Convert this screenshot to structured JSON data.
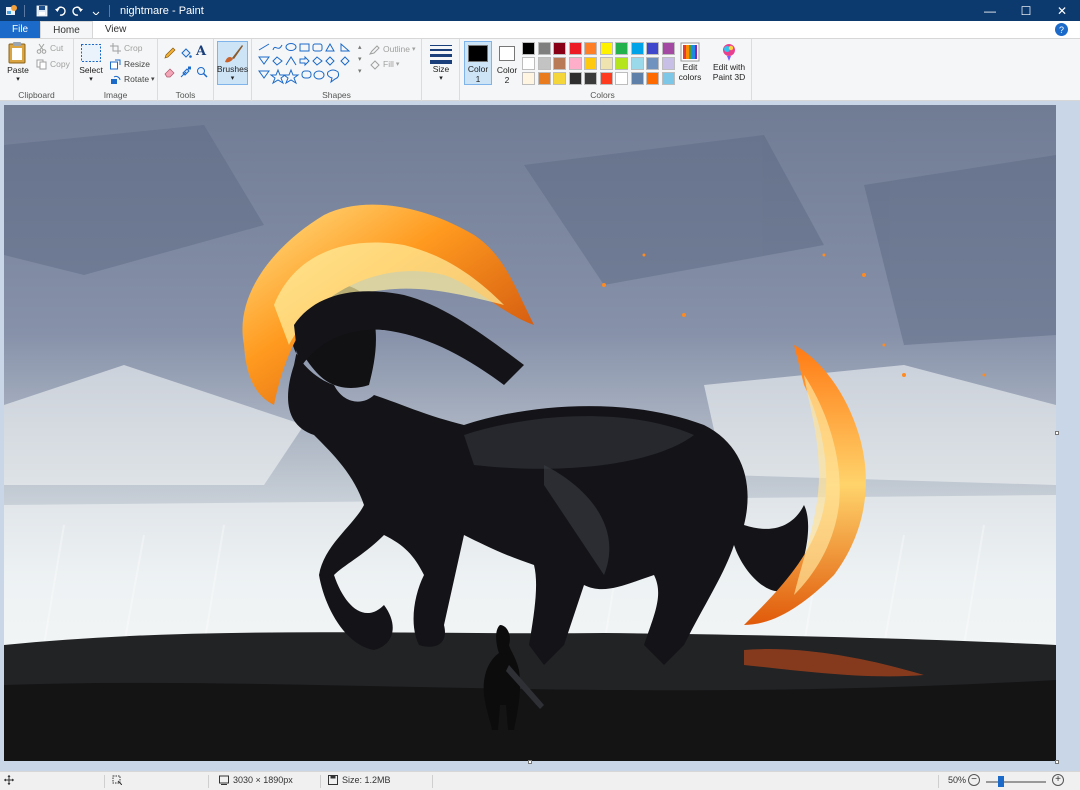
{
  "window": {
    "title": "nightmare - Paint",
    "minimize_glyph": "—",
    "maximize_glyph": "☐",
    "close_glyph": "✕"
  },
  "quick_access": {
    "items": [
      "save-icon",
      "undo-icon",
      "redo-icon",
      "customize-icon"
    ]
  },
  "tabs": {
    "file": "File",
    "home": "Home",
    "view": "View",
    "help_glyph": "?"
  },
  "clipboard": {
    "paste": "Paste",
    "cut": "Cut",
    "copy": "Copy",
    "label": "Clipboard"
  },
  "image": {
    "select": "Select",
    "crop": "Crop",
    "resize": "Resize",
    "rotate": "Rotate",
    "label": "Image"
  },
  "tools": {
    "label": "Tools",
    "text_glyph": "A"
  },
  "brushes": {
    "label": "Brushes"
  },
  "shapes": {
    "outline": "Outline",
    "fill": "Fill",
    "label": "Shapes"
  },
  "size": {
    "label": "Size"
  },
  "colors": {
    "color1_label": "Color",
    "color1_num": "1",
    "color2_label": "Color",
    "color2_num": "2",
    "color1_value": "#000000",
    "color2_value": "#ffffff",
    "edit_colors_l1": "Edit",
    "edit_colors_l2": "colors",
    "edit_3d_l1": "Edit with",
    "edit_3d_l2": "Paint 3D",
    "label": "Colors",
    "palette_row1": [
      "#000000",
      "#7f7f7f",
      "#880015",
      "#ed1c24",
      "#ff7f27",
      "#fff200",
      "#22b14c",
      "#00a2e8",
      "#3f48cc",
      "#a349a4"
    ],
    "palette_row2": [
      "#ffffff",
      "#c3c3c3",
      "#b97a57",
      "#ffaec9",
      "#ffc90e",
      "#efe4b0",
      "#b5e61d",
      "#99d9ea",
      "#7092be",
      "#c8bfe7"
    ],
    "palette_row3": [
      "#fff5e1",
      "#e87c1f",
      "#f5d63a",
      "#2e2e2e",
      "#3a3a3a",
      "#ff3b1f",
      "#ffffff",
      "#5d7fa8",
      "#ff6a00",
      "#7cc6e8"
    ]
  },
  "status": {
    "dimensions": "3030 × 1890px",
    "size": "Size: 1.2MB",
    "zoom": "50%",
    "zoom_out_glyph": "−",
    "zoom_in_glyph": "+"
  },
  "canvas": {
    "image_name": "nightmare"
  }
}
